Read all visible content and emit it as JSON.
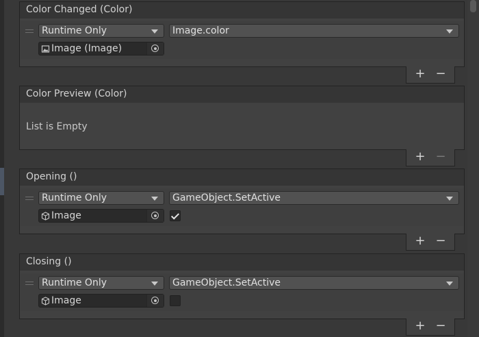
{
  "events": [
    {
      "title": "Color Changed (Color)",
      "listeners": [
        {
          "runtime_option": "Runtime Only",
          "function": "Image.color",
          "target_object": "Image (Image)",
          "target_icon": "image-component-icon"
        }
      ],
      "footer": {
        "add": "+",
        "remove": "−"
      }
    },
    {
      "title": "Color Preview  (Color)",
      "empty_text": "List is Empty",
      "footer": {
        "add": "+",
        "remove": "−"
      }
    },
    {
      "title": "Opening ()",
      "listeners": [
        {
          "runtime_option": "Runtime Only",
          "function": "GameObject.SetActive",
          "target_object": "Image",
          "target_icon": "gameobject-cube-icon",
          "bool_param": true
        }
      ],
      "footer": {
        "add": "+",
        "remove": "−"
      }
    },
    {
      "title": "Closing ()",
      "listeners": [
        {
          "runtime_option": "Runtime Only",
          "function": "GameObject.SetActive",
          "target_object": "Image",
          "target_icon": "gameobject-cube-icon",
          "bool_param": false
        }
      ],
      "footer": {
        "add": "+",
        "remove": "−"
      }
    }
  ]
}
